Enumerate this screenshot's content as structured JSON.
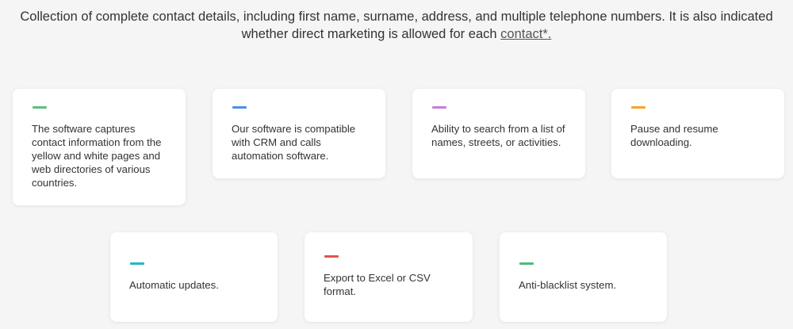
{
  "intro": {
    "text_before_link": "Collection of complete contact details, including first name, surname, address, and multiple telephone numbers. It is also indicated whether direct marketing is allowed for each ",
    "link_text": "contact*."
  },
  "features": [
    {
      "text": "The software captures contact information from the yellow and white pages and web directories of various countries.",
      "color": "#5dbf7e"
    },
    {
      "text": "Our software is compatible with CRM and calls automation software.",
      "color": "#4a90e2"
    },
    {
      "text": "Ability to search from a list of names, streets, or activities.",
      "color": "#c77ddf"
    },
    {
      "text": "Pause and resume downloading.",
      "color": "#f5a623"
    },
    {
      "text": "Automatic updates.",
      "color": "#26b6c9"
    },
    {
      "text": "Export to Excel or CSV format.",
      "color": "#e0544e"
    },
    {
      "text": "Anti-blacklist system.",
      "color": "#50b884"
    }
  ]
}
